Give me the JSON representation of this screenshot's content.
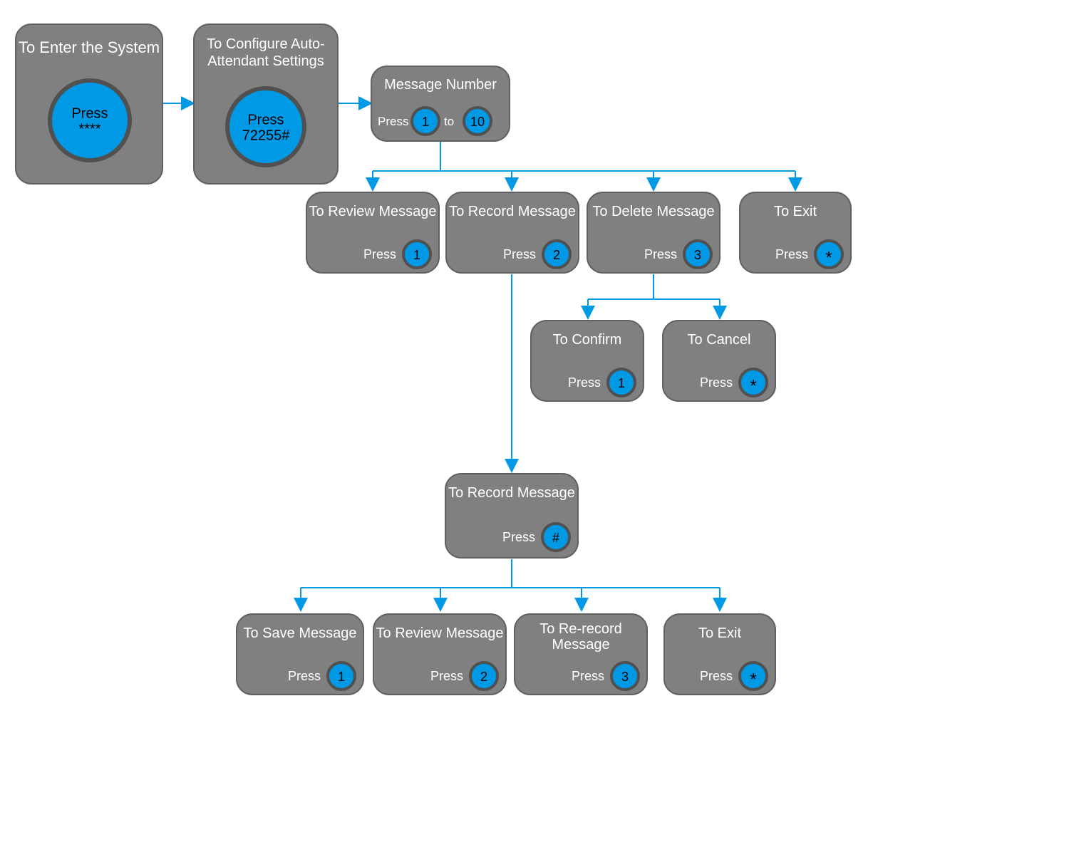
{
  "colors": {
    "node": "#808080",
    "accent": "#0099e5"
  },
  "nodes": {
    "enter": {
      "title": "To Enter the System",
      "press": "Press",
      "key": "****"
    },
    "config": {
      "title1": "To Configure Auto-",
      "title2": "Attendant Settings",
      "press": "Press",
      "key": "72255#"
    },
    "msgnum": {
      "title": "Message Number",
      "press": "Press",
      "to": "to",
      "key1": "1",
      "key2": "10"
    },
    "review": {
      "title": "To Review Message",
      "press": "Press",
      "key": "1"
    },
    "record": {
      "title": "To Record Message",
      "press": "Press",
      "key": "2"
    },
    "delete": {
      "title": "To Delete Message",
      "press": "Press",
      "key": "3"
    },
    "exit1": {
      "title": "To Exit",
      "press": "Press",
      "key": "*"
    },
    "confirm": {
      "title": "To Confirm",
      "press": "Press",
      "key": "1"
    },
    "cancel": {
      "title": "To Cancel",
      "press": "Press",
      "key": "*"
    },
    "record2": {
      "title": "To Record Message",
      "press": "Press",
      "key": "#"
    },
    "save": {
      "title": "To Save Message",
      "press": "Press",
      "key": "1"
    },
    "review2": {
      "title": "To Review Message",
      "press": "Press",
      "key": "2"
    },
    "rerecord": {
      "title1": "To Re-record",
      "title2": "Message",
      "press": "Press",
      "key": "3"
    },
    "exit2": {
      "title": "To Exit",
      "press": "Press",
      "key": "*"
    }
  }
}
